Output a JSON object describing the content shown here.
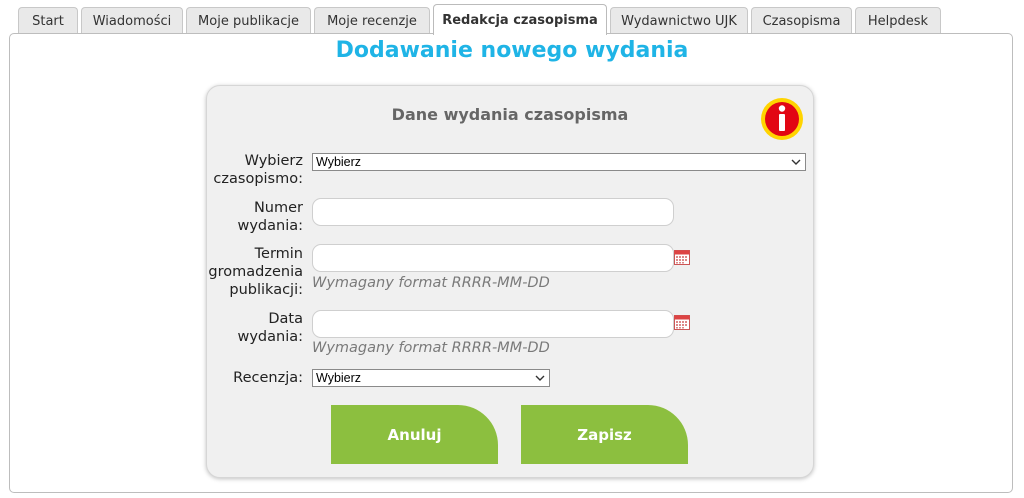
{
  "tabs": [
    {
      "label": "Start",
      "active": false
    },
    {
      "label": "Wiadomości",
      "active": false
    },
    {
      "label": "Moje publikacje",
      "active": false
    },
    {
      "label": "Moje recenzje",
      "active": false
    },
    {
      "label": "Redakcja czasopisma",
      "active": true
    },
    {
      "label": "Wydawnictwo UJK",
      "active": false
    },
    {
      "label": "Czasopisma",
      "active": false
    },
    {
      "label": "Helpdesk",
      "active": false
    }
  ],
  "page": {
    "title": "Dodawanie nowego wydania"
  },
  "form": {
    "heading": "Dane wydania czasopisma",
    "journal": {
      "label_line1": "Wybierz",
      "label_line2": "czasopismo:",
      "selected": "Wybierz"
    },
    "issue_number": {
      "label_line1": "Numer",
      "label_line2": "wydania:",
      "value": ""
    },
    "deadline": {
      "label_line1": "Termin",
      "label_line2": "gromadzenia",
      "label_line3": "publikacji:",
      "value": "",
      "hint": "Wymagany format RRRR-MM-DD"
    },
    "issue_date": {
      "label_line1": "Data",
      "label_line2": "wydania:",
      "value": "",
      "hint": "Wymagany format RRRR-MM-DD"
    },
    "review": {
      "label": "Recenzja:",
      "selected": "Wybierz"
    },
    "cancel_label": "Anuluj",
    "save_label": "Zapisz"
  },
  "colors": {
    "title": "#1fb4e6",
    "button": "#8cbf3f",
    "info_icon": "#e20613",
    "info_ring": "#ffd400"
  },
  "icons": {
    "info": "info-icon",
    "calendar": "calendar-icon",
    "dropdown": "chevron-down-icon"
  }
}
